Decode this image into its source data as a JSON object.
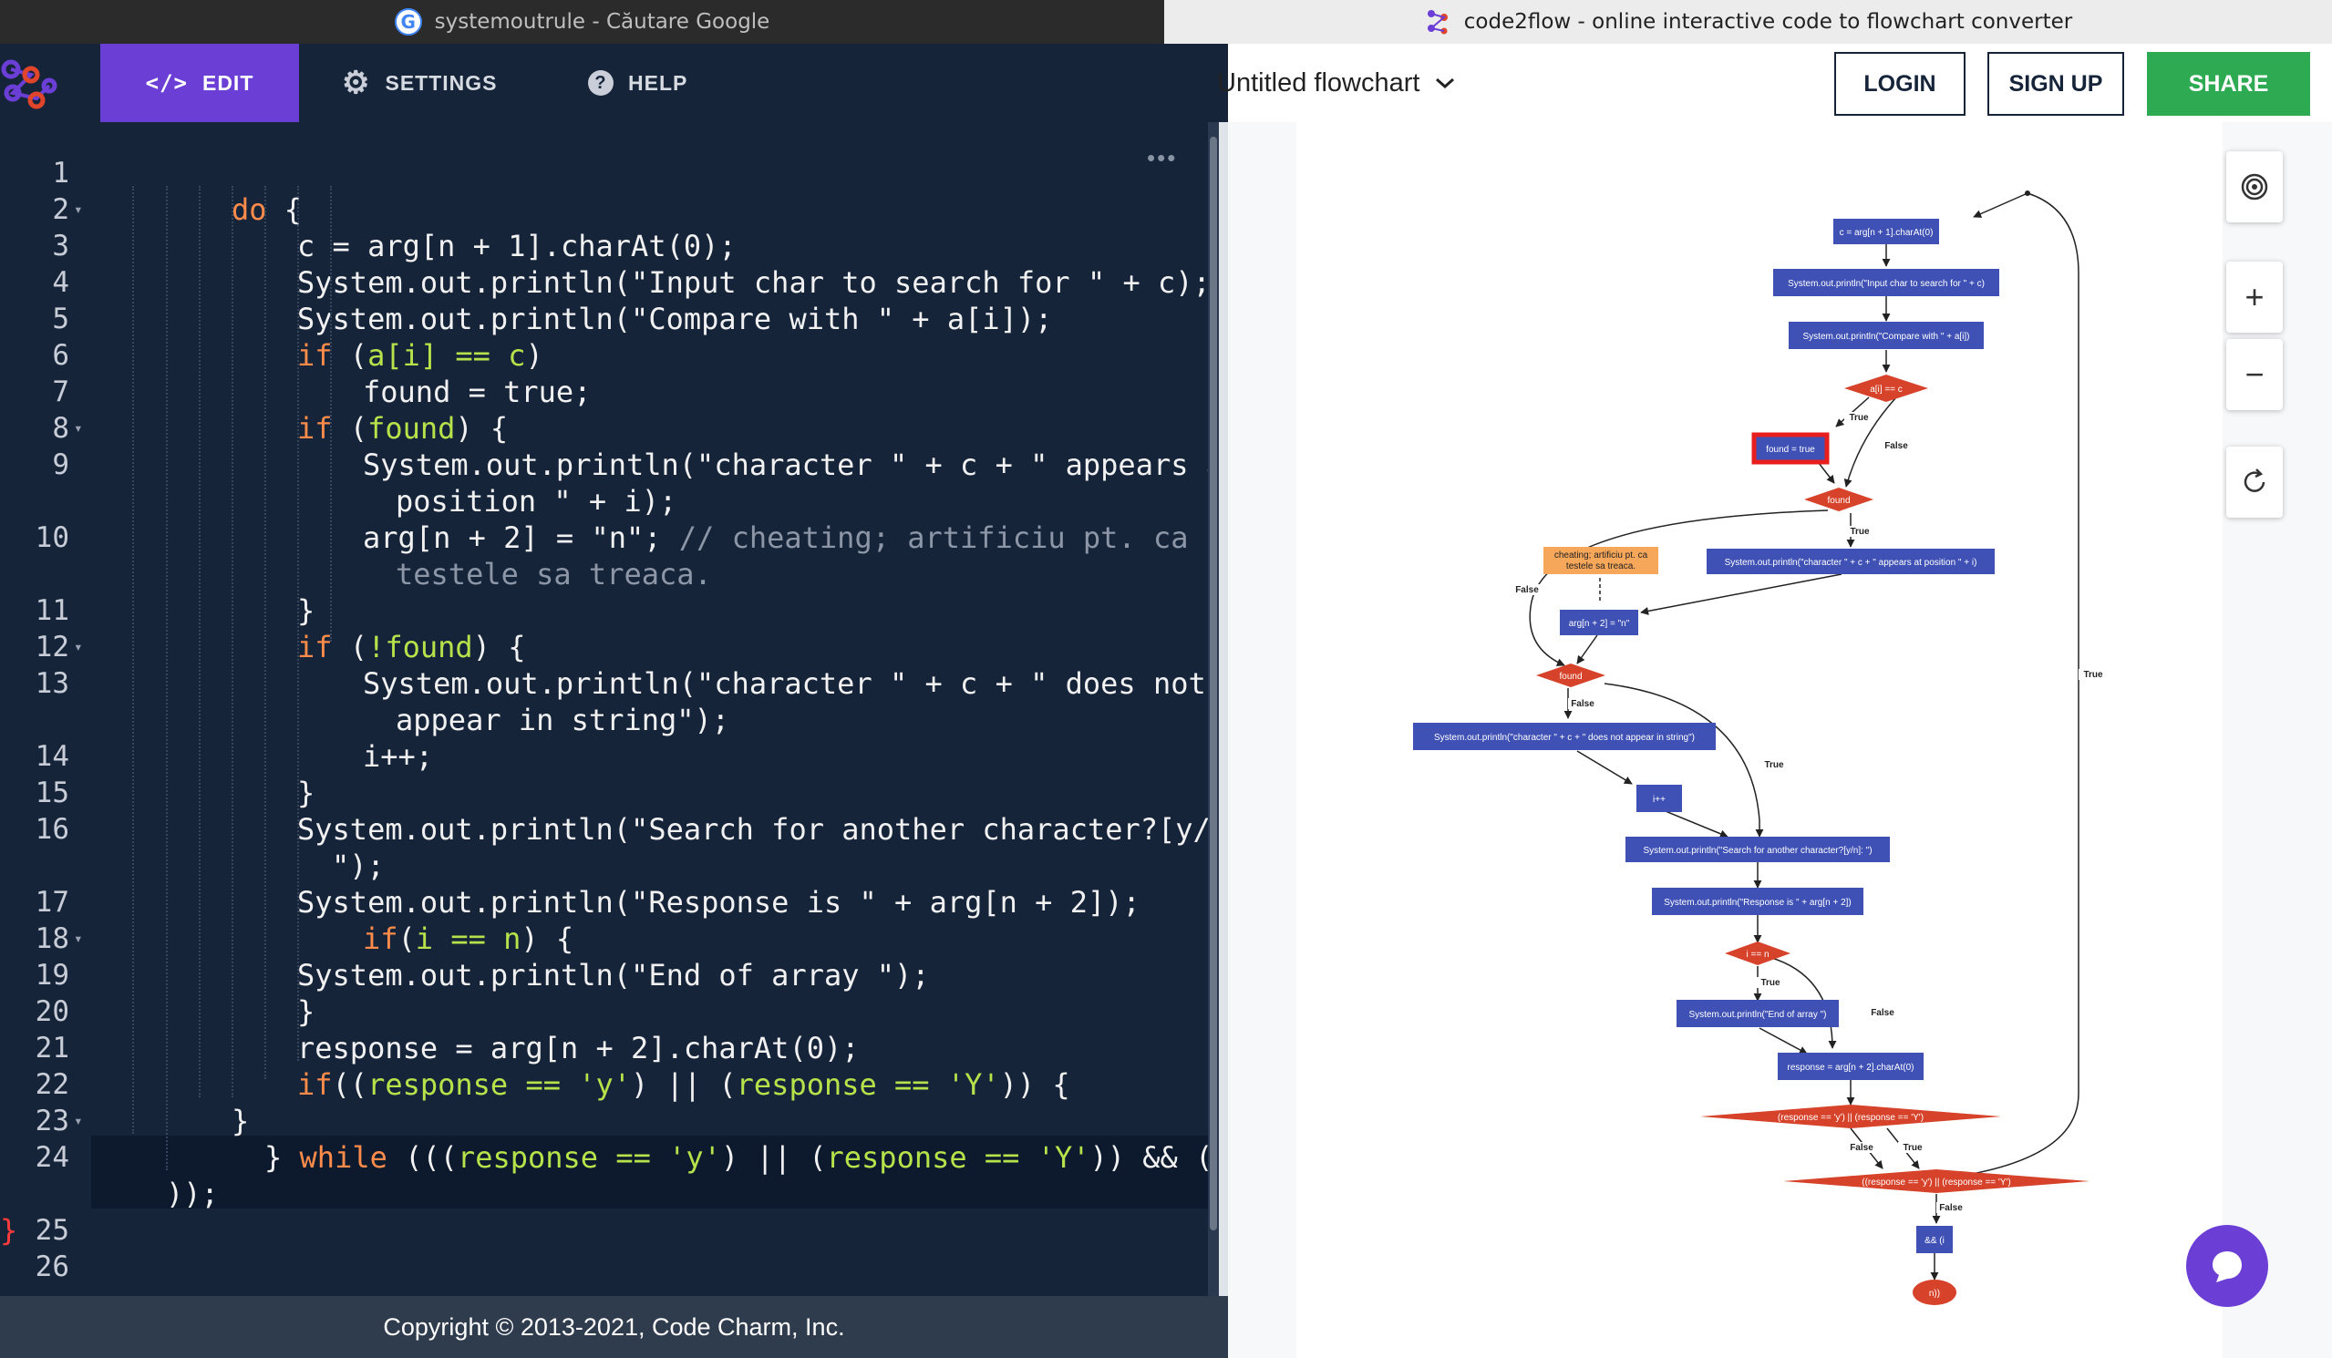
{
  "browser": {
    "tabs": [
      {
        "title": "systemoutrule - Căutare Google",
        "icon": "google-icon"
      },
      {
        "title": "code2flow - online interactive code to flowchart converter",
        "icon": "code2flow-icon"
      }
    ]
  },
  "nav": {
    "edit": "EDIT",
    "settings": "SETTINGS",
    "help": "HELP"
  },
  "header": {
    "title": "Untitled flowchart",
    "login": "LOGIN",
    "signup": "SIGN UP",
    "share": "SHARE"
  },
  "editor": {
    "lines": [
      {
        "n": "1",
        "parts": []
      },
      {
        "n": "2",
        "parts": [
          {
            "t": "do",
            "c": "kw"
          },
          {
            "t": " {",
            "c": ""
          }
        ]
      },
      {
        "n": "3",
        "parts": [
          {
            "t": "c = arg[n + 1].charAt(0);",
            "c": ""
          }
        ]
      },
      {
        "n": "4",
        "parts": [
          {
            "t": "System.out.println(\"Input char to search for \" + c);",
            "c": ""
          }
        ]
      },
      {
        "n": "5",
        "parts": [
          {
            "t": "System.out.println(\"Compare with \" + a[i]);",
            "c": ""
          }
        ]
      },
      {
        "n": "6",
        "parts": [
          {
            "t": "if",
            "c": "kw"
          },
          {
            "t": " (",
            "c": ""
          },
          {
            "t": "a[i] == c",
            "c": "grn"
          },
          {
            "t": ")",
            "c": ""
          }
        ]
      },
      {
        "n": "7",
        "parts": [
          {
            "t": "found = true;",
            "c": ""
          }
        ]
      },
      {
        "n": "8",
        "parts": [
          {
            "t": "if",
            "c": "kw"
          },
          {
            "t": " (",
            "c": ""
          },
          {
            "t": "found",
            "c": "grn"
          },
          {
            "t": ") {",
            "c": ""
          }
        ]
      },
      {
        "n": "9",
        "parts": [
          {
            "t": "System.out.println(\"character \" + c + \" appears at",
            "c": ""
          }
        ]
      },
      {
        "n": "",
        "parts": [
          {
            "t": "position \" + i);",
            "c": ""
          }
        ]
      },
      {
        "n": "10",
        "parts": [
          {
            "t": "arg[n + 2] = \"n\"; ",
            "c": ""
          },
          {
            "t": "// cheating; artificiu pt. ca",
            "c": "cm"
          }
        ]
      },
      {
        "n": "",
        "parts": [
          {
            "t": "testele sa treaca.",
            "c": "cm"
          }
        ]
      },
      {
        "n": "11",
        "parts": [
          {
            "t": "}",
            "c": ""
          }
        ]
      },
      {
        "n": "12",
        "parts": [
          {
            "t": "if",
            "c": "kw"
          },
          {
            "t": " (",
            "c": ""
          },
          {
            "t": "!found",
            "c": "grn"
          },
          {
            "t": ") {",
            "c": ""
          }
        ]
      },
      {
        "n": "13",
        "parts": [
          {
            "t": "System.out.println(\"character \" + c + \" does not",
            "c": ""
          }
        ]
      },
      {
        "n": "",
        "parts": [
          {
            "t": "appear in string\");",
            "c": ""
          }
        ]
      },
      {
        "n": "14",
        "parts": [
          {
            "t": "i++;",
            "c": ""
          }
        ]
      },
      {
        "n": "15",
        "parts": [
          {
            "t": "}",
            "c": ""
          }
        ]
      },
      {
        "n": "16",
        "parts": [
          {
            "t": "System.out.println(\"Search for another character?[y/n]:",
            "c": ""
          }
        ]
      },
      {
        "n": "",
        "parts": [
          {
            "t": "\");",
            "c": ""
          }
        ]
      },
      {
        "n": "17",
        "parts": [
          {
            "t": "System.out.println(\"Response is \" + arg[n + 2]);",
            "c": ""
          }
        ]
      },
      {
        "n": "18",
        "parts": [
          {
            "t": "if",
            "c": "kw"
          },
          {
            "t": "(",
            "c": ""
          },
          {
            "t": "i == n",
            "c": "grn"
          },
          {
            "t": ") {",
            "c": ""
          }
        ]
      },
      {
        "n": "19",
        "parts": [
          {
            "t": "System.out.println(\"End of array \");",
            "c": ""
          }
        ]
      },
      {
        "n": "20",
        "parts": [
          {
            "t": "}",
            "c": ""
          }
        ]
      },
      {
        "n": "21",
        "parts": [
          {
            "t": "response = arg[n + 2].charAt(0);",
            "c": ""
          }
        ]
      },
      {
        "n": "22",
        "parts": [
          {
            "t": "if",
            "c": "kw"
          },
          {
            "t": "((",
            "c": ""
          },
          {
            "t": "response == 'y'",
            "c": "grn"
          },
          {
            "t": ") || (",
            "c": ""
          },
          {
            "t": "response == 'Y'",
            "c": "grn"
          },
          {
            "t": ")) {",
            "c": ""
          }
        ]
      },
      {
        "n": "23",
        "parts": [
          {
            "t": "}",
            "c": ""
          }
        ]
      },
      {
        "n": "24",
        "parts": [
          {
            "t": "} ",
            "c": ""
          },
          {
            "t": "while",
            "c": "kw"
          },
          {
            "t": " (((",
            "c": ""
          },
          {
            "t": "response == 'y'",
            "c": "grn"
          },
          {
            "t": ") || (",
            "c": ""
          },
          {
            "t": "response == 'Y'",
            "c": "grn"
          },
          {
            "t": ")) && (i ",
            "c": ""
          },
          {
            "t": "<",
            "c": "err"
          },
          {
            "t": ";n",
            "c": ""
          }
        ]
      },
      {
        "n": "",
        "parts": [
          {
            "t": "));",
            "c": ""
          }
        ]
      },
      {
        "n": "25",
        "parts": [
          {
            "t": "}",
            "c": "err"
          }
        ]
      },
      {
        "n": "26",
        "parts": []
      }
    ]
  },
  "footer": {
    "copyright": "Copyright © 2013-2021, Code Charm, Inc."
  },
  "flowchart": {
    "boxes": {
      "b1": "c = arg[n + 1].charAt(0)",
      "b2": "System.out.println(\"Input char to search for \" + c)",
      "b3": "System.out.println(\"Compare with \" + a[i])",
      "d1": "a[i] == c",
      "b4": "found = true",
      "d2": "found",
      "b5": "System.out.println(\"character \" + c + \" appears at position \" + i)",
      "note": [
        "cheating; artificiu pt. ca",
        "testele sa treaca."
      ],
      "b6": "arg[n + 2] = \"n\"",
      "d3": "found",
      "b7": "System.out.println(\"character \" + c + \" does not appear in string\")",
      "b8": "i++",
      "b9": "System.out.println(\"Search for another character?[y/n]: \")",
      "b10": "System.out.println(\"Response is \" + arg[n + 2])",
      "d4": "i == n",
      "b11": "System.out.println(\"End of array \")",
      "b12": "response = arg[n + 2].charAt(0)",
      "d5": "(response == 'y') || (response == 'Y')",
      "d6": "((response == 'y') || (response == 'Y')",
      "b13": "&& (i",
      "end": "n))"
    },
    "labels": {
      "true": "True",
      "false": "False"
    }
  }
}
